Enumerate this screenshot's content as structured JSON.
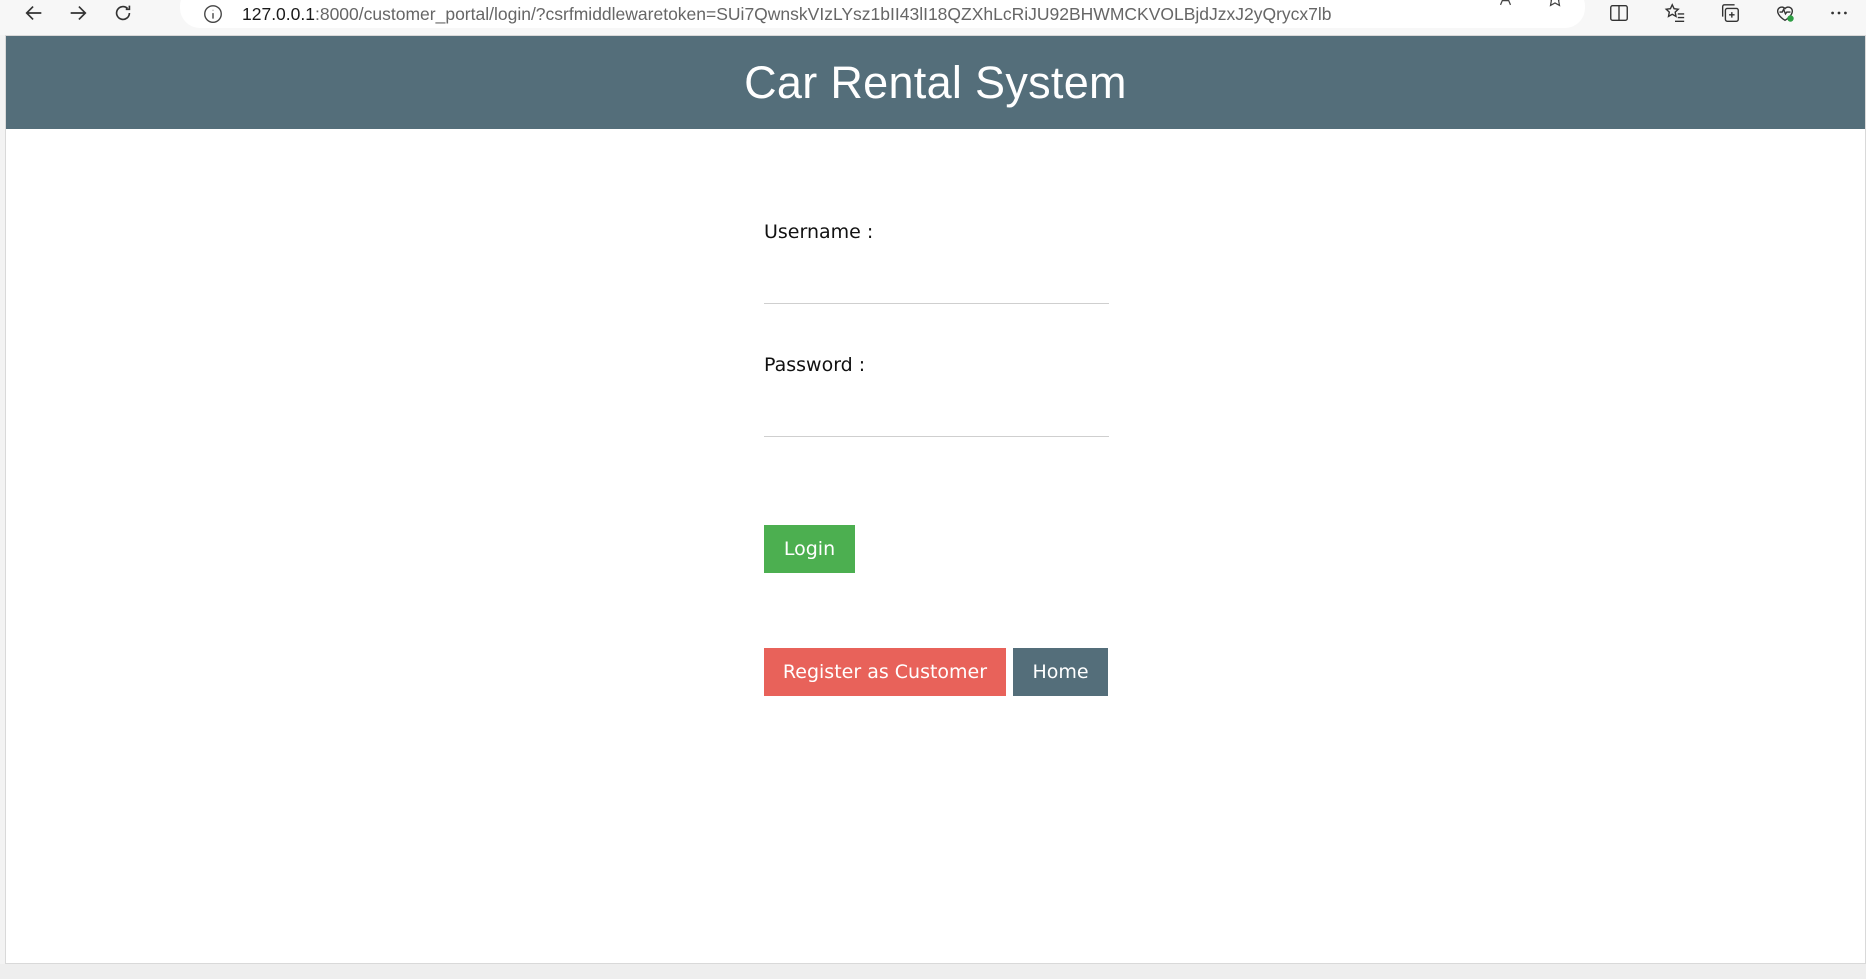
{
  "browser": {
    "url_host": "127.0.0.1",
    "url_rest": ":8000/customer_portal/login/?csrfmiddlewaretoken=SUi7QwnskVIzLYsz1bII43lI18QZXhLcRiJU92BHWMCKVOLBjdJzxJ2yQrycx7lb",
    "icons": [
      "back-arrow-icon",
      "forward-arrow-icon",
      "refresh-icon",
      "info-icon",
      "read-aloud-icon",
      "favorite-star-icon",
      "split-screen-icon",
      "favorites-icon",
      "collections-icon",
      "browser-essentials-icon",
      "more-options-icon"
    ]
  },
  "header": {
    "title": "Car Rental System",
    "bg_color": "#546e7a"
  },
  "form": {
    "username_label": "Username :",
    "username_value": "",
    "password_label": "Password :",
    "password_value": "",
    "login_label": "Login",
    "register_label": "Register as Customer",
    "home_label": "Home"
  },
  "colors": {
    "login": "#4caf50",
    "register": "#e8625a",
    "home": "#546e7a"
  }
}
